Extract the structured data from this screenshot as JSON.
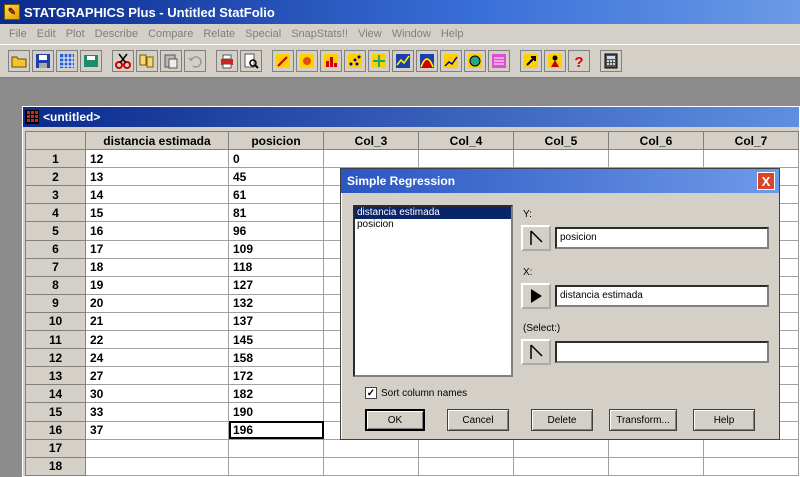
{
  "app": {
    "title": "STATGRAPHICS Plus - Untitled StatFolio",
    "icon": "statgraphics-app-icon"
  },
  "menu": [
    "File",
    "Edit",
    "Plot",
    "Describe",
    "Compare",
    "Relate",
    "Special",
    "SnapStats!!",
    "View",
    "Window",
    "Help"
  ],
  "toolbar": {
    "groups": [
      [
        "open-folder-icon",
        "save-disk-icon",
        "spreadsheet-icon",
        "save-all-icon"
      ],
      [
        "cut-icon",
        "copy-icon",
        "paste-icon",
        "undo-icon"
      ],
      [
        "print-icon",
        "print-preview-icon"
      ],
      [
        "wizard-icon",
        "star-icon",
        "bar-chart-icon",
        "scatter-icon",
        "multi-icon",
        "line-plot-icon",
        "distribution-icon",
        "trend-icon",
        "globe-icon",
        "stats-table-icon"
      ],
      [
        "question-arrow-icon",
        "person-icon",
        "help-question-icon"
      ],
      [
        "calculator-icon"
      ]
    ]
  },
  "sheet": {
    "title": "<untitled>",
    "columns": [
      "distancia estimada",
      "posicion",
      "Col_3",
      "Col_4",
      "Col_5",
      "Col_6",
      "Col_7"
    ],
    "row_numbers": [
      "1",
      "2",
      "3",
      "4",
      "5",
      "6",
      "7",
      "8",
      "9",
      "10",
      "11",
      "12",
      "13",
      "14",
      "15",
      "16",
      "17",
      "18"
    ],
    "rows": [
      [
        "12",
        "0"
      ],
      [
        "13",
        "45"
      ],
      [
        "14",
        "61"
      ],
      [
        "15",
        "81"
      ],
      [
        "16",
        "96"
      ],
      [
        "17",
        "109"
      ],
      [
        "18",
        "118"
      ],
      [
        "19",
        "127"
      ],
      [
        "20",
        "132"
      ],
      [
        "21",
        "137"
      ],
      [
        "22",
        "145"
      ],
      [
        "24",
        "158"
      ],
      [
        "27",
        "172"
      ],
      [
        "30",
        "182"
      ],
      [
        "33",
        "190"
      ],
      [
        "37",
        "196"
      ],
      [
        "",
        ""
      ],
      [
        "",
        ""
      ]
    ]
  },
  "dialog": {
    "title": "Simple Regression",
    "close_label": "X",
    "variables": [
      "distancia estimada",
      "posicion"
    ],
    "y_label": "Y:",
    "y_value": "posicion",
    "x_label": "X:",
    "x_value": "distancia estimada",
    "select_label": "(Select:)",
    "select_value": "",
    "sort_label": "Sort column names",
    "sort_checked": true,
    "buttons": {
      "ok": "OK",
      "cancel": "Cancel",
      "delete": "Delete",
      "transform": "Transform...",
      "help": "Help"
    }
  }
}
